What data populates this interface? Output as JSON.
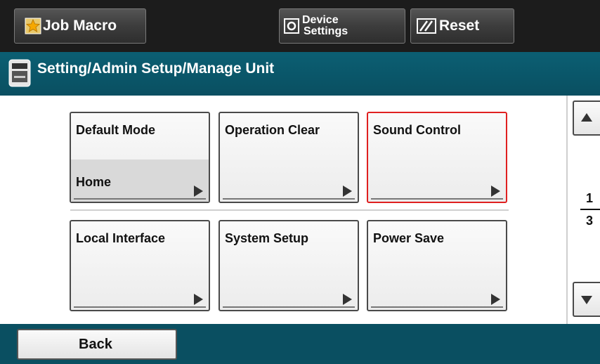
{
  "topbar": {
    "job_macro_label": "Job Macro",
    "device_settings_line1": "Device",
    "device_settings_line2": "Settings",
    "reset_label": "Reset"
  },
  "titlebar": {
    "title": "Setting/Admin Setup/Manage Unit"
  },
  "tiles": [
    {
      "label": "Default Mode",
      "value": "Home",
      "selected": false
    },
    {
      "label": "Operation Clear",
      "value": "",
      "selected": false
    },
    {
      "label": "Sound Control",
      "value": "",
      "selected": true
    },
    {
      "label": "Local Interface",
      "value": "",
      "selected": false
    },
    {
      "label": "System Setup",
      "value": "",
      "selected": false
    },
    {
      "label": "Power Save",
      "value": "",
      "selected": false
    }
  ],
  "pagination": {
    "current": "1",
    "total": "3"
  },
  "bottombar": {
    "back_label": "Back"
  },
  "colors": {
    "header_bg": "#1c1c1c",
    "title_bg": "#0b5f73",
    "selected_border": "#e02020"
  }
}
